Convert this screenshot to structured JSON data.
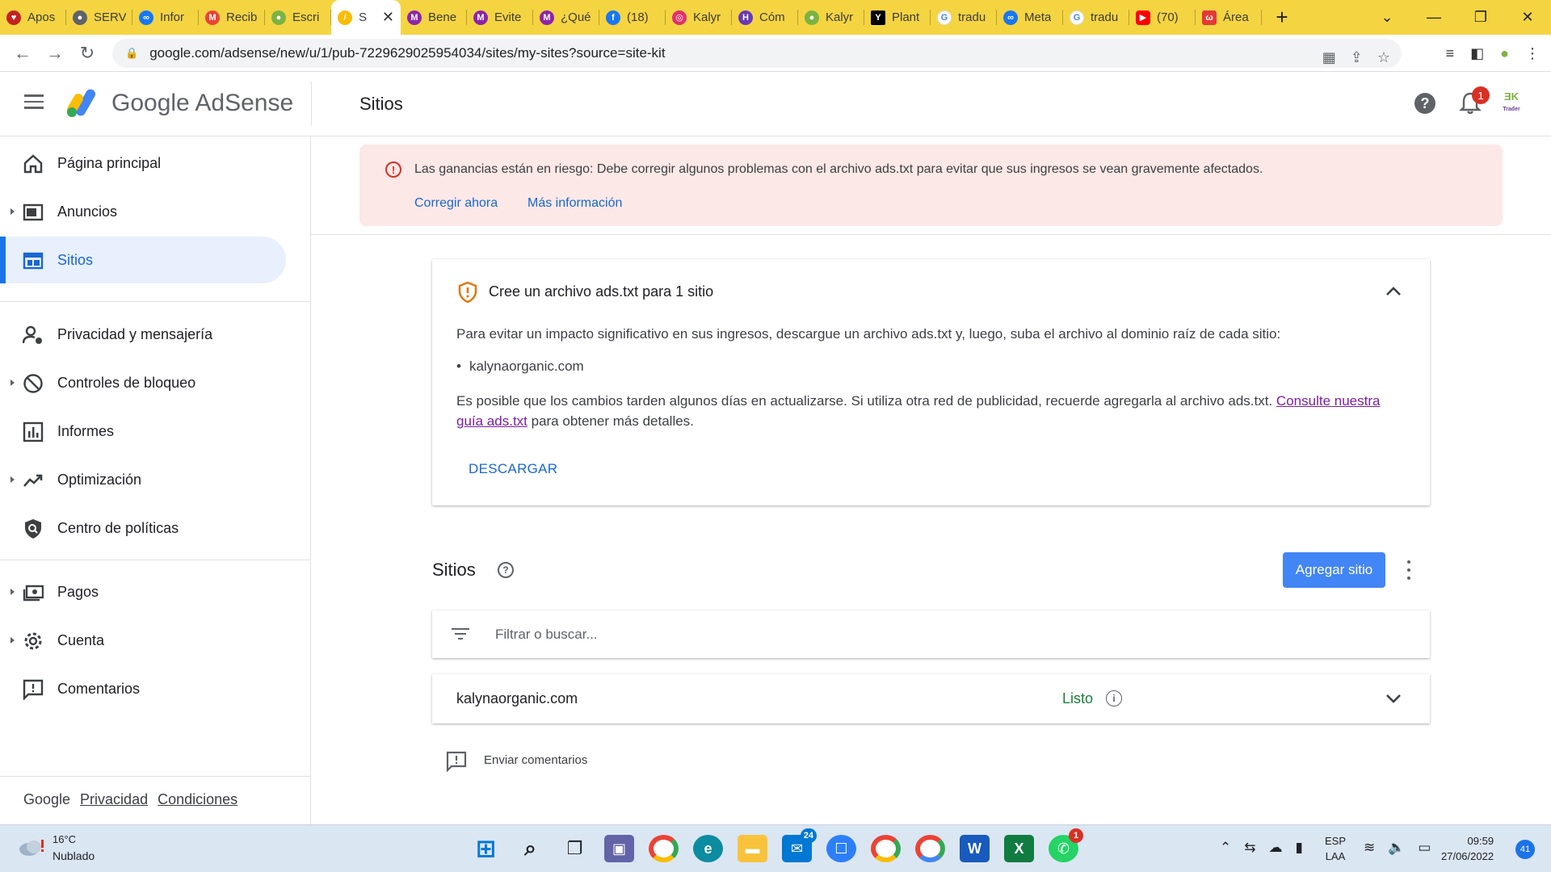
{
  "browser": {
    "tabs": [
      {
        "label": "Apos",
        "color": "#c5221f"
      },
      {
        "label": "SERV",
        "color": "#5f6368"
      },
      {
        "label": "Infor",
        "color": "#1877f2"
      },
      {
        "label": "Recib",
        "color": "#ea4335"
      },
      {
        "label": "Escri",
        "color": "#7cb342"
      },
      {
        "label": "S",
        "color": "#fbbc04",
        "active": true
      },
      {
        "label": "Bene",
        "color": "#8e24aa"
      },
      {
        "label": "Evite",
        "color": "#8e24aa"
      },
      {
        "label": "¿Qué",
        "color": "#8e24aa"
      },
      {
        "label": "(18)",
        "color": "#1877f2"
      },
      {
        "label": "Kalyr",
        "color": "#e1306c"
      },
      {
        "label": "Cóm",
        "color": "#673ab7"
      },
      {
        "label": "Kalyr",
        "color": "#7cb342"
      },
      {
        "label": "Plant",
        "color": "#000000"
      },
      {
        "label": "tradu",
        "color": "#4285f4"
      },
      {
        "label": "Meta",
        "color": "#1877f2"
      },
      {
        "label": "tradu",
        "color": "#4285f4"
      },
      {
        "label": "(70)",
        "color": "#ff0000"
      },
      {
        "label": "Área",
        "color": "#e53935"
      }
    ],
    "url": "google.com/adsense/new/u/1/pub-7229629025954034/sites/my-sites?source=site-kit"
  },
  "header": {
    "brand": "Google AdSense",
    "page_title": "Sitios",
    "notification_count": "1",
    "avatar_text": "Trader"
  },
  "sidebar": {
    "items": [
      {
        "label": "Página principal"
      },
      {
        "label": "Anuncios"
      },
      {
        "label": "Sitios"
      },
      {
        "label": "Privacidad y mensajería"
      },
      {
        "label": "Controles de bloqueo"
      },
      {
        "label": "Informes"
      },
      {
        "label": "Optimización"
      },
      {
        "label": "Centro de políticas"
      },
      {
        "label": "Pagos"
      },
      {
        "label": "Cuenta"
      },
      {
        "label": "Comentarios"
      }
    ],
    "footer": {
      "google": "Google",
      "privacy": "Privacidad",
      "terms": "Condiciones"
    }
  },
  "alert": {
    "text": "Las ganancias están en riesgo: Debe corregir algunos problemas con el archivo ads.txt para evitar que sus ingresos se vean gravemente afectados.",
    "fix_now": "Corregir ahora",
    "more_info": "Más información"
  },
  "ads_card": {
    "title": "Cree un archivo ads.txt para 1 sitio",
    "intro": "Para evitar un impacto significativo en sus ingresos, descargue un archivo ads.txt y, luego, suba el archivo al dominio raíz de cada sitio:",
    "site": "kalynaorganic.com",
    "note_before": "Es posible que los cambios tarden algunos días en actualizarse. Si utiliza otra red de publicidad, recuerde agregarla al archivo ads.txt. ",
    "note_link": "Consulte nuestra guía ads.txt",
    "note_after": " para obtener más detalles.",
    "download": "DESCARGAR"
  },
  "sites": {
    "title": "Sitios",
    "add_button": "Agregar sitio",
    "filter_placeholder": "Filtrar o buscar...",
    "rows": [
      {
        "name": "kalynaorganic.com",
        "status": "Listo"
      }
    ],
    "feedback": "Enviar comentarios"
  },
  "taskbar": {
    "temperature": "16°C",
    "weather": "Nublado",
    "mail_badge": "24",
    "whatsapp_badge": "1",
    "lang_top": "ESP",
    "lang_bottom": "LAA",
    "time": "09:59",
    "date": "27/06/2022",
    "notifications": "41"
  }
}
